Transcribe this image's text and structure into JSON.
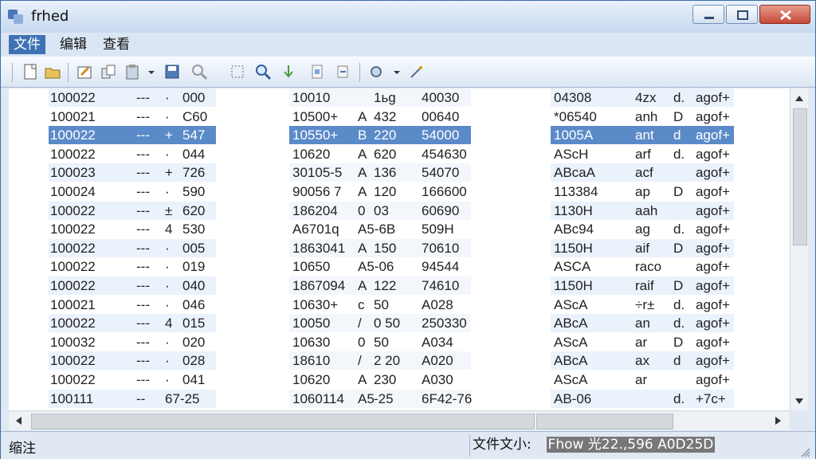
{
  "window": {
    "title": "frhed"
  },
  "menu": [
    "文件",
    "编辑",
    "查看"
  ],
  "toolbar": [
    "new-file-icon",
    "open-file-icon",
    "edit-icon",
    "copy-icon",
    "paste-icon",
    "dropdown-arrow-icon",
    "save-icon",
    "find-icon",
    "grid-icon",
    "zoom-icon",
    "down-arrow-icon",
    "bookmark-icon",
    "bookmark-next-icon",
    "settings-icon",
    "dropdown-arrow-icon",
    "wand-icon"
  ],
  "rows": [
    [
      "100022",
      "---",
      "·",
      "000",
      "10010",
      "",
      "1ьg",
      "40030",
      "04308",
      "4zx",
      "d.",
      "agof+"
    ],
    [
      "100021",
      "---",
      "·",
      "C60",
      "10500+",
      "A",
      "432",
      "00640",
      "*06540",
      "anh",
      "D",
      "agof+"
    ],
    [
      "100022",
      "---",
      "+",
      "547",
      "10550+",
      "B",
      "220",
      "54000",
      "1005A",
      "ant",
      "d",
      "agof+"
    ],
    [
      "100022",
      "---",
      "·",
      "044",
      "10620",
      "A",
      "620",
      "454630",
      "AScH",
      "arf",
      "d.",
      "agof+"
    ],
    [
      "100023",
      "---",
      "+",
      "726",
      "30105-5",
      "A",
      "136",
      "54070",
      "ABcaA",
      "acf",
      "",
      "agof+"
    ],
    [
      "100024",
      "---",
      "·",
      "590",
      "90056 7",
      "A",
      "120",
      "166600",
      "113384",
      "ap",
      "D",
      "agof+"
    ],
    [
      "100022",
      "---",
      "±",
      "620",
      "186204",
      "0",
      "03",
      "60690",
      "1130H",
      "aah",
      "",
      "agof+"
    ],
    [
      "100022",
      "---",
      "4",
      "530",
      "A6701q",
      "A5-6B",
      "",
      "509H",
      "ABc94",
      "ag",
      "d.",
      "agof+"
    ],
    [
      "100022",
      "---",
      "·",
      "005",
      "1863041",
      "A",
      "150",
      "70610",
      "1150H",
      "aif",
      "D",
      "agof+"
    ],
    [
      "100022",
      "---",
      "·",
      "019",
      "10650",
      "A5-06",
      "",
      "94544",
      "ASCA",
      "raco",
      "",
      "agof+"
    ],
    [
      "100022",
      "---",
      "·",
      "040",
      "1867094",
      "A",
      "122",
      "74610",
      "1150H",
      "raif",
      "D",
      "agof+"
    ],
    [
      "100021",
      "---",
      "·",
      "046",
      "10630+",
      "c",
      "50",
      "A028",
      "AScA",
      "÷r±",
      "d.",
      "agof+"
    ],
    [
      "100022",
      "---",
      "4",
      "015",
      "10050",
      "/",
      "0 50",
      "250330",
      "ABcA",
      "an",
      "d.",
      "agof+"
    ],
    [
      "100032",
      "---",
      "·",
      "020",
      "10630",
      "0",
      "50",
      "A034",
      "AScA",
      "ar",
      "D",
      "agof+"
    ],
    [
      "100022",
      "---",
      "·",
      "028",
      "18610",
      "/",
      "2 20",
      "A020",
      "ABcA",
      "ax",
      "d",
      "agof+"
    ],
    [
      "100022",
      "---",
      "·",
      "041",
      "10620",
      "A",
      "230",
      "A030",
      "AScA",
      "ar",
      "",
      "agof+"
    ],
    [
      "100111",
      "--",
      "67-25",
      "",
      "1060114",
      "A5",
      "-25",
      "6F42-76",
      "AB-06",
      "",
      "d.",
      "+7c+"
    ]
  ],
  "status": {
    "left": "缩注",
    "right_label": "文件文小:",
    "right_value": "Fhow 光22.,596 A0D25D"
  }
}
